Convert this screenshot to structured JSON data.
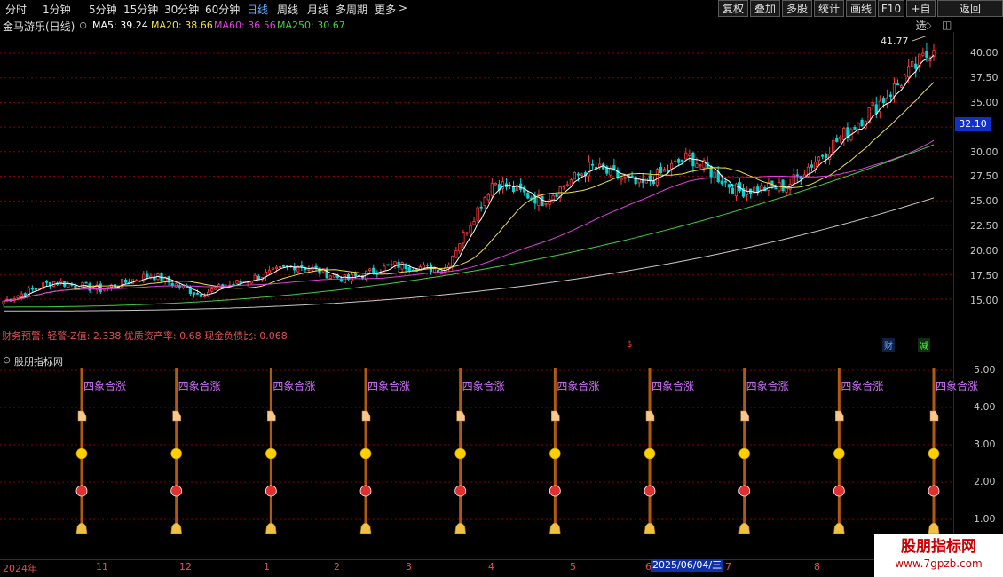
{
  "toolbar": {
    "periods": [
      "分时",
      "1分钟",
      "5分钟",
      "15分钟",
      "30分钟",
      "60分钟",
      "日线",
      "周线",
      "月线",
      "多周期",
      "更多"
    ],
    "active_period": "日线",
    "more_arrow": ">",
    "buttons": [
      "复权",
      "叠加",
      "多股",
      "统计",
      "画线",
      "F10",
      "+自选",
      "返回"
    ]
  },
  "header": {
    "stock_title": "金马游乐(日线)",
    "ma_items": [
      {
        "label": "MA5: 39.24",
        "color": "#ffffff"
      },
      {
        "label": "MA20: 38.66",
        "color": "#f0e040"
      },
      {
        "label": "MA60: 36.56",
        "color": "#e040e0"
      },
      {
        "label": "MA250: 30.67",
        "color": "#40d040"
      }
    ],
    "collapse_icon": "chevron-down-icon"
  },
  "colors": {
    "up": "#ff3c3c",
    "down": "#00d8d8",
    "ma5": "#ffffff",
    "ma20": "#f0e040",
    "ma60": "#e040e0",
    "ma250": "#40d040",
    "ma_long": "#c8c8c8",
    "grid": "#8b0000",
    "signal": "#d070ff"
  },
  "main_chart": {
    "high_label": "41.77",
    "current_price": "32.10",
    "y_ticks": [
      "40.00",
      "37.50",
      "35.00",
      "32.50",
      "30.00",
      "27.50",
      "25.00",
      "22.50",
      "20.00",
      "17.50",
      "15.00"
    ],
    "financial_note": "财务预警: 轻警-Z值: 2.338 优质资产率: 0.68 现金负债比: 0.068",
    "markers": [
      {
        "text": "$",
        "color": "#ff3c3c"
      },
      {
        "text": "财",
        "color": "#60a0ff"
      },
      {
        "text": "减",
        "color": "#40ff40"
      }
    ]
  },
  "indicator": {
    "title": "股朋指标网",
    "signal_label": "四象合涨",
    "y_ticks": [
      "5.00",
      "4.00",
      "3.00",
      "2.00",
      "1.00"
    ],
    "signal_icons": [
      "hand-pointer-icon",
      "smiley-icon",
      "red-ball-icon",
      "money-bag-icon"
    ]
  },
  "x_axis": {
    "labels": [
      "2024年",
      "11",
      "12",
      "1",
      "2",
      "3",
      "4",
      "5",
      "6",
      "7",
      "8"
    ],
    "cursor_date": "2025/06/04/三"
  },
  "watermark": {
    "title": "股朋指标网",
    "url": "www.7gpzb.com"
  },
  "chart_data": {
    "type": "candlestick",
    "title": "金马游乐(日线)",
    "period": "daily",
    "ylim": [
      12.5,
      42.5
    ],
    "x_range": [
      "2024-10",
      "2025-08"
    ],
    "price_waypoints": [
      {
        "date": "2024-10",
        "close": 14.8
      },
      {
        "date": "2024-10",
        "close": 16.8
      },
      {
        "date": "2024-11",
        "close": 16.0
      },
      {
        "date": "2024-12",
        "close": 17.5
      },
      {
        "date": "2025-01",
        "close": 15.5
      },
      {
        "date": "2025-02",
        "close": 17.0
      },
      {
        "date": "2025-03",
        "close": 18.5
      },
      {
        "date": "2025-04",
        "close": 17.0
      },
      {
        "date": "2025-04",
        "close": 18.5
      },
      {
        "date": "2025-05",
        "close": 18.0
      },
      {
        "date": "2025-05",
        "close": 27.0
      },
      {
        "date": "2025-06",
        "close": 25.0
      },
      {
        "date": "2025-06",
        "close": 28.5
      },
      {
        "date": "2025-07",
        "close": 26.5
      },
      {
        "date": "2025-07",
        "close": 29.5
      },
      {
        "date": "2025-07",
        "close": 26.0
      },
      {
        "date": "2025-08",
        "close": 26.5
      },
      {
        "date": "2025-08",
        "close": 31.0
      },
      {
        "date": "2025-08",
        "close": 35.5
      },
      {
        "date": "2025-08",
        "close": 40.5
      }
    ],
    "high": 41.77,
    "last_ma": {
      "MA5": 39.24,
      "MA20": 38.66,
      "MA60": 36.56,
      "MA250": 30.67
    },
    "signals": {
      "label": "四象合涨",
      "count": 10,
      "levels": [
        1,
        2,
        3,
        4
      ],
      "indicator_ylim": [
        0.5,
        5.5
      ]
    }
  }
}
